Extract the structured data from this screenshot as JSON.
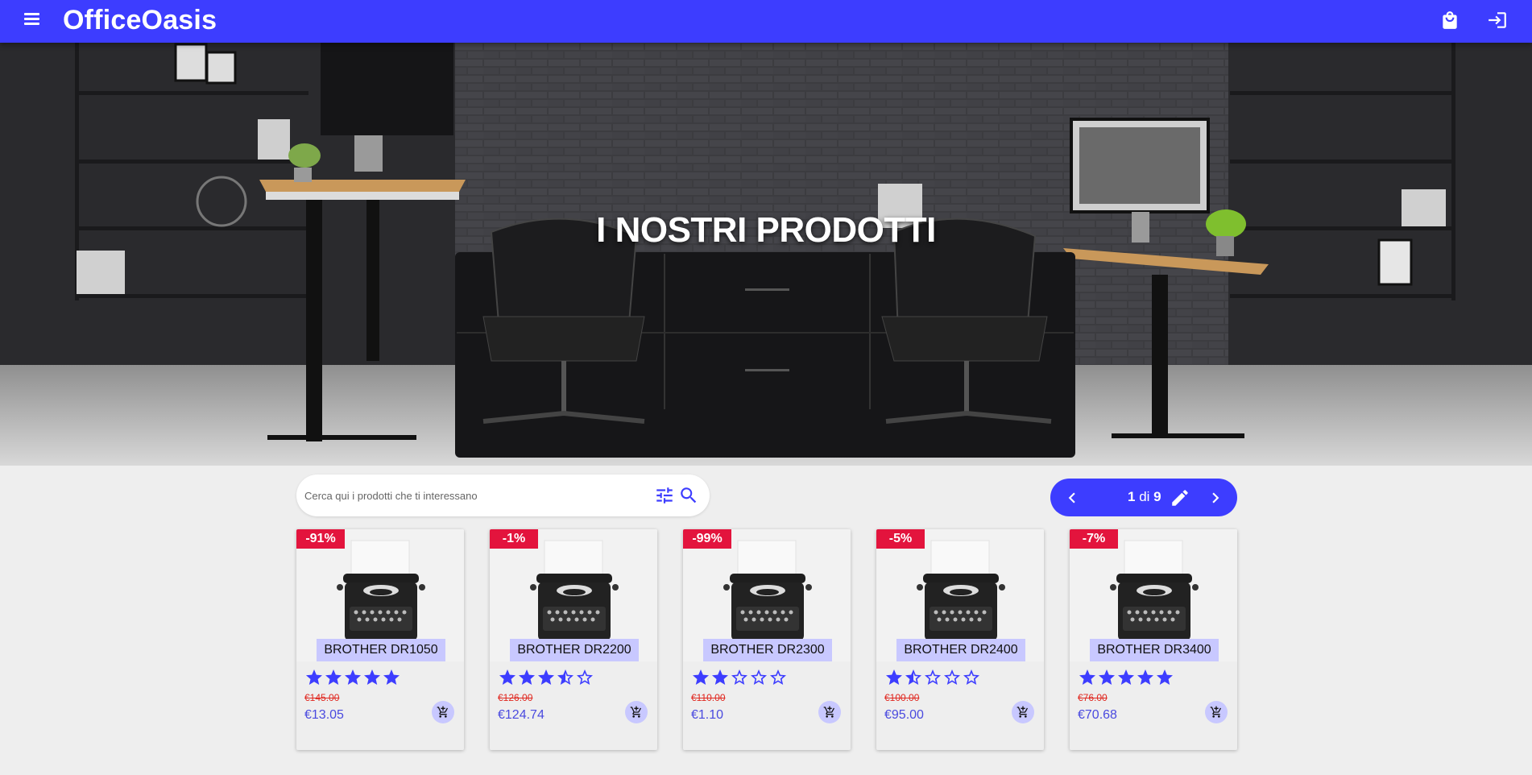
{
  "app": {
    "title": "OfficeOasis"
  },
  "header": {
    "menu_icon": "menu-icon",
    "bag_icon": "shopping-bag-icon",
    "login_icon": "login-icon"
  },
  "hero": {
    "title": "I NOSTRI PRODOTTI"
  },
  "search": {
    "placeholder": "Cerca qui i prodotti che ti interessano",
    "value": "",
    "filter_icon": "tune-icon",
    "search_icon": "search-icon"
  },
  "pager": {
    "current": "1",
    "separator": "di",
    "total": "9",
    "prev_icon": "chevron-left-icon",
    "next_icon": "chevron-right-icon",
    "edit_icon": "pencil-icon"
  },
  "products": [
    {
      "name": "BROTHER DR1050",
      "discount": "-91%",
      "rating": 5,
      "old_price": "€145.00",
      "price": "€13.05"
    },
    {
      "name": "BROTHER DR2200",
      "discount": "-1%",
      "rating": 3.5,
      "old_price": "€126.00",
      "price": "€124.74"
    },
    {
      "name": "BROTHER DR2300",
      "discount": "-99%",
      "rating": 2,
      "old_price": "€110.00",
      "price": "€1.10"
    },
    {
      "name": "BROTHER DR2400",
      "discount": "-5%",
      "rating": 1.5,
      "old_price": "€100.00",
      "price": "€95.00"
    },
    {
      "name": "BROTHER DR3400",
      "discount": "-7%",
      "rating": 5,
      "old_price": "€76.00",
      "price": "€70.68"
    }
  ],
  "colors": {
    "primary": "#3d3dff",
    "badge": "#e3143d",
    "name_chip": "#c8c8ff",
    "price": "#4a4adf",
    "old_price": "#e0261e",
    "background": "#eeeeee"
  }
}
